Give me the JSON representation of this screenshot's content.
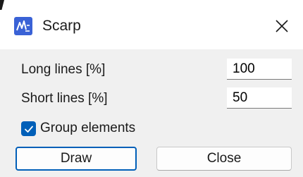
{
  "window": {
    "title": "Scarp",
    "app_icon": "scarp-app-icon",
    "close_icon": "close-icon"
  },
  "form": {
    "long_lines": {
      "label": "Long lines [%]",
      "value": "100"
    },
    "short_lines": {
      "label": "Short lines [%]",
      "value": "50"
    },
    "group_elements": {
      "label": "Group elements",
      "checked": true
    }
  },
  "buttons": {
    "draw": "Draw",
    "close": "Close"
  },
  "colors": {
    "accent": "#005fb8",
    "dialog_bg": "#f0f0f0",
    "titlebar_bg": "#ffffff"
  }
}
